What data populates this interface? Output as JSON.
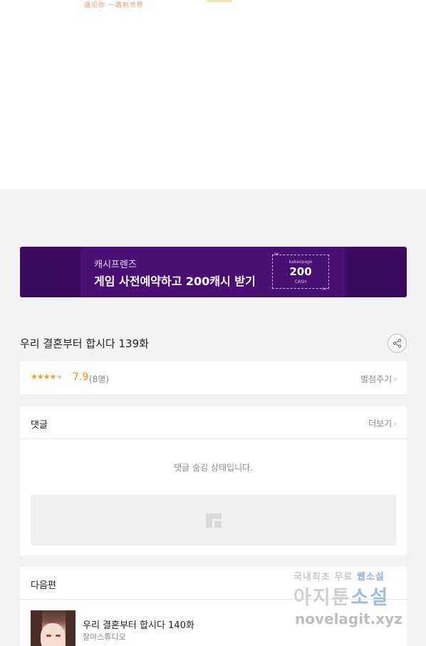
{
  "top_art": {
    "caption": "遇见你 一路到世界"
  },
  "banner": {
    "brand": "캐시프렌즈",
    "headline": "게임 사전예약하고 200캐시 받기",
    "ticket_top": "kakaopage",
    "ticket_amount": "200",
    "ticket_cash": "CASH"
  },
  "episode": {
    "title": "우리 결혼부터 합시다 139화",
    "share_icon": "share-icon"
  },
  "rating": {
    "stars_filled": "★★★★",
    "stars_empty": "★",
    "score": "7.9",
    "count": "(8명)",
    "rate_label": "별점주기"
  },
  "comments": {
    "heading": "댓글",
    "more_label": "더보기",
    "hidden_message": "댓글 숨김 상태입니다."
  },
  "next_episode": {
    "heading": "다음편",
    "title": "우리 결혼부터 합시다 140화",
    "studio": "잘아스튜디오"
  },
  "watermark": {
    "line1_prefix": "국내최초 무료 ",
    "line1_accent": "웹소설",
    "line2_prefix": "아지툰",
    "line2_accent": "소설",
    "line3": "novelagit.xyz"
  },
  "colors": {
    "banner_bg": "#3c0a5e",
    "score": "#ff8a00",
    "page_bg": "#f3f3f3"
  }
}
